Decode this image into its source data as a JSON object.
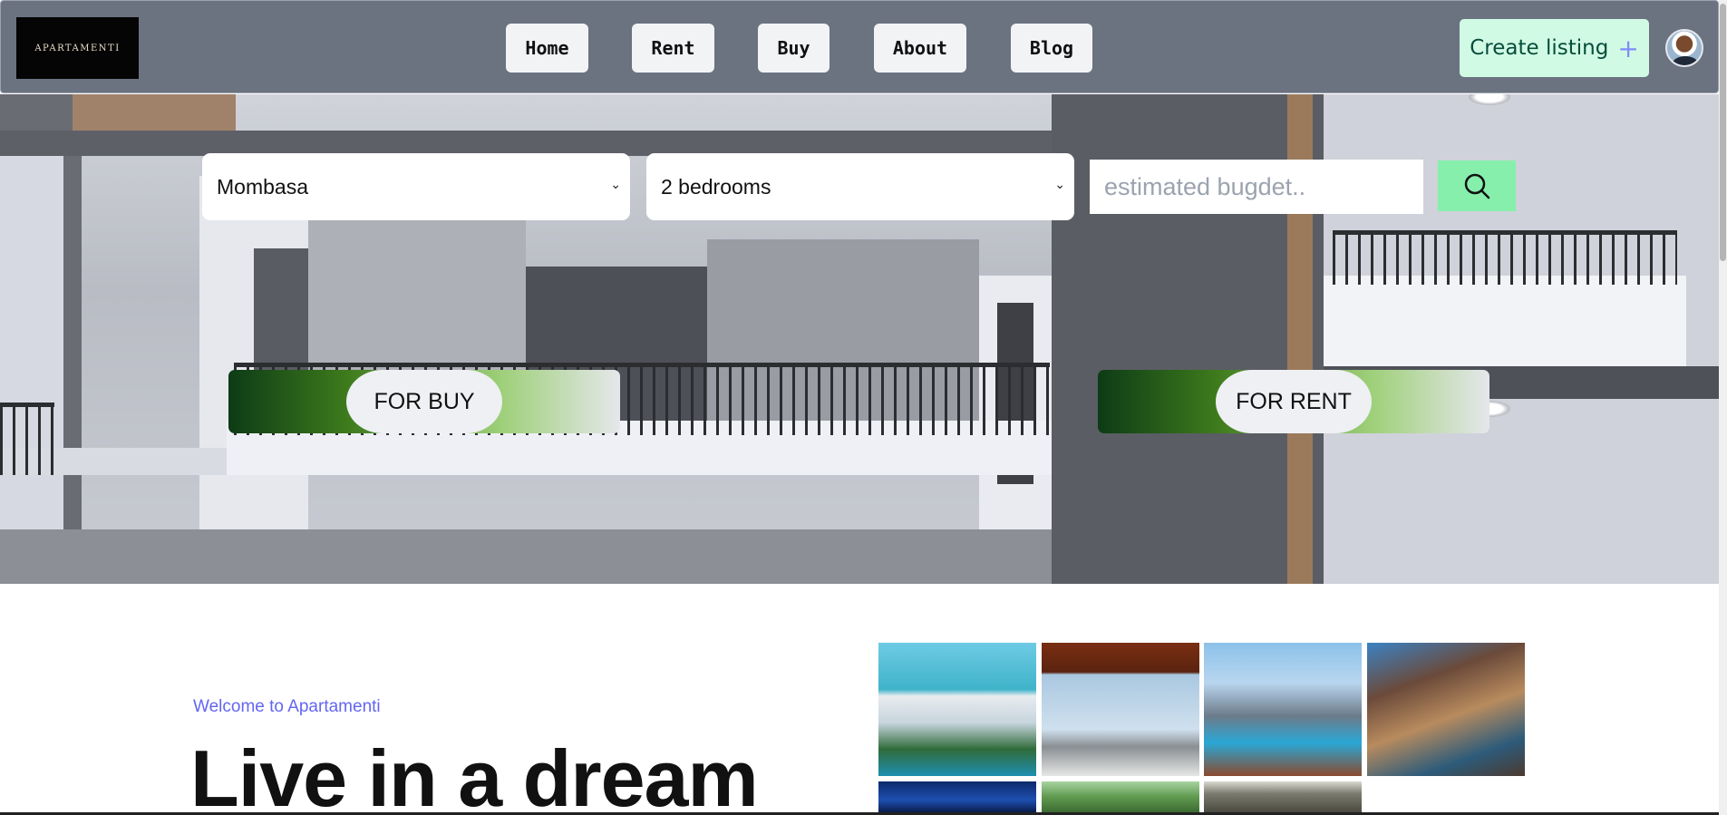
{
  "brand": {
    "logo_text": "APARTAMENTI"
  },
  "nav": {
    "items": [
      {
        "label": "Home"
      },
      {
        "label": "Rent"
      },
      {
        "label": "Buy"
      },
      {
        "label": "About"
      },
      {
        "label": "Blog"
      }
    ],
    "create_listing_label": "Create listing",
    "create_listing_icon": "plus-icon"
  },
  "search": {
    "location_value": "Mombasa",
    "bedrooms_value": "2 bedrooms",
    "budget_placeholder": "estimated bugdet..",
    "search_icon": "search-icon"
  },
  "hero": {
    "for_buy_label": "FOR BUY",
    "for_rent_label": "FOR RENT"
  },
  "intro": {
    "welcome": "Welcome to Apartamenti",
    "headline": "Live in a dream"
  },
  "colors": {
    "header_bg": "#6b7280",
    "create_btn_bg": "#d1fae5",
    "search_btn_bg": "#86efac",
    "accent_text": "#6366f1",
    "pill_gradient_start": "#0d3b16"
  }
}
